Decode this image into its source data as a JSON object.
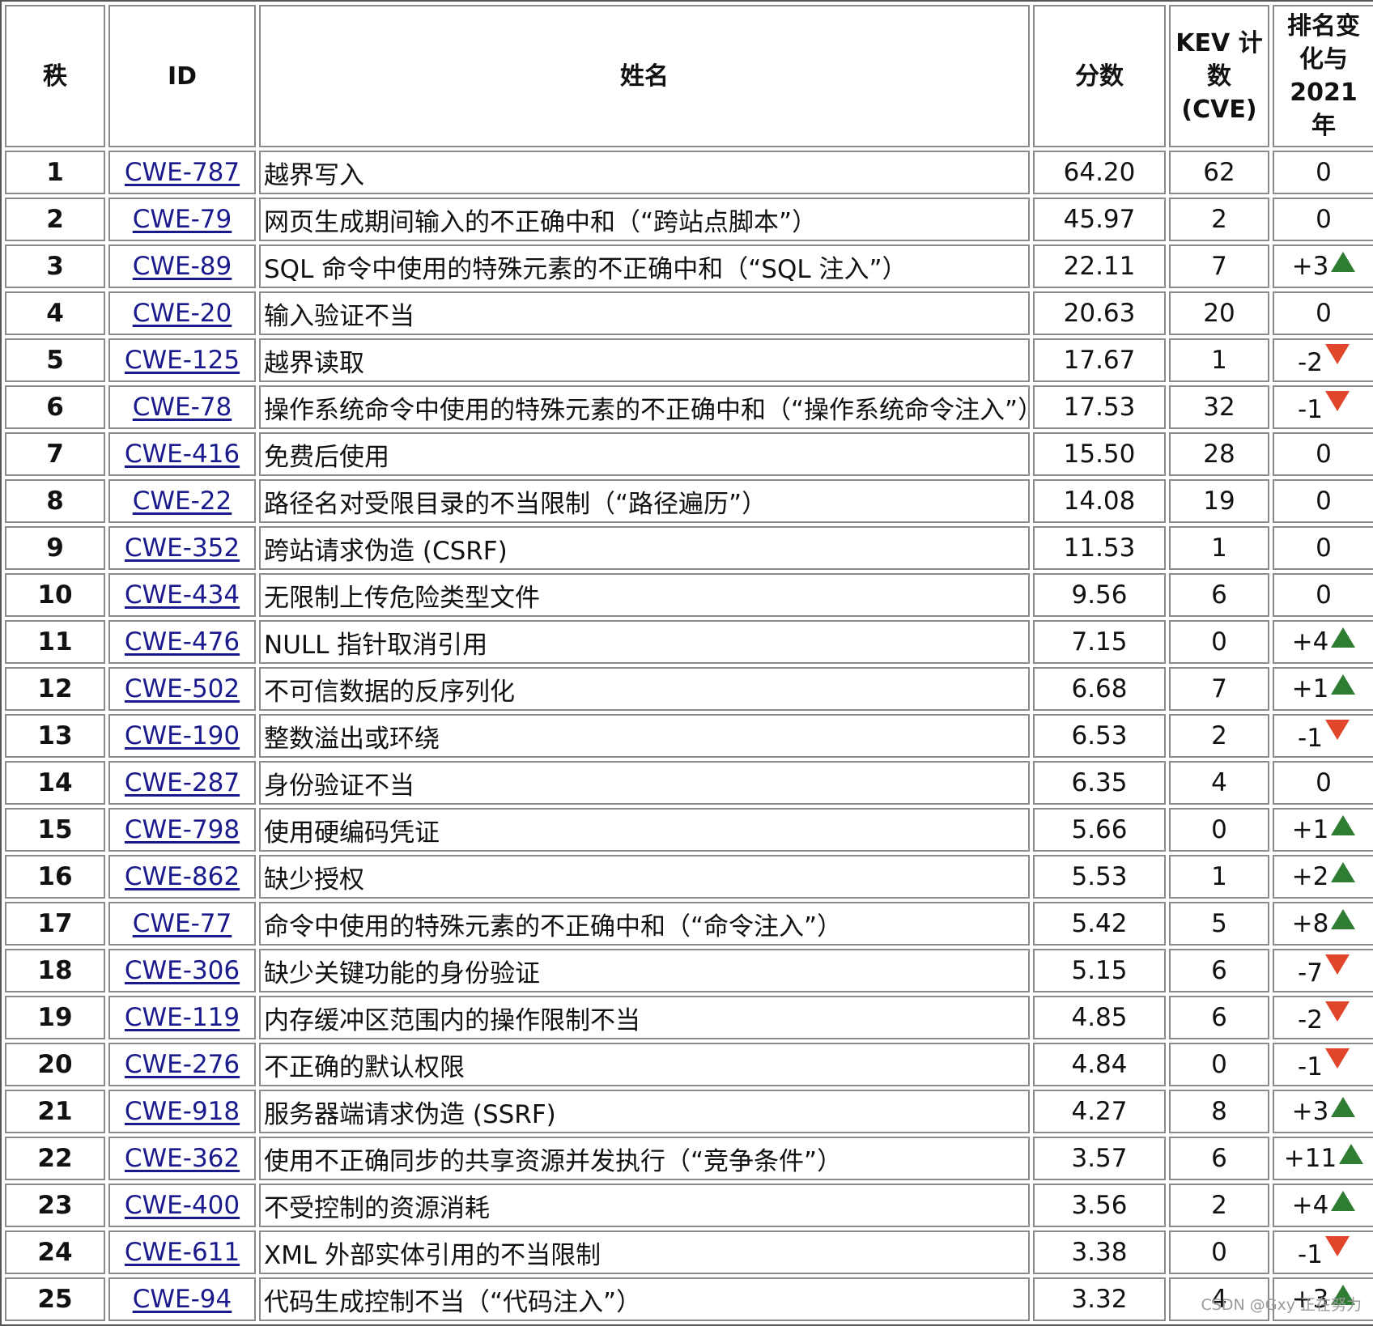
{
  "headers": {
    "rank": "秩",
    "id": "ID",
    "name": "姓名",
    "score": "分数",
    "kev": "KEV 计数 (CVE)",
    "change": "排名变化与 2021 年"
  },
  "rows": [
    {
      "rank": "1",
      "id": "CWE-787",
      "name": "越界写入",
      "score": "64.20",
      "kev": "62",
      "change": "0",
      "trend": "none"
    },
    {
      "rank": "2",
      "id": "CWE-79",
      "name": "网页生成期间输入的不正确中和（“跨站点脚本”）",
      "score": "45.97",
      "kev": "2",
      "change": "0",
      "trend": "none"
    },
    {
      "rank": "3",
      "id": "CWE-89",
      "name": "SQL 命令中使用的特殊元素的不正确中和（“SQL 注入”）",
      "score": "22.11",
      "kev": "7",
      "change": "+3",
      "trend": "up"
    },
    {
      "rank": "4",
      "id": "CWE-20",
      "name": "输入验证不当",
      "score": "20.63",
      "kev": "20",
      "change": "0",
      "trend": "none"
    },
    {
      "rank": "5",
      "id": "CWE-125",
      "name": "越界读取",
      "score": "17.67",
      "kev": "1",
      "change": "-2",
      "trend": "down"
    },
    {
      "rank": "6",
      "id": "CWE-78",
      "name": "操作系统命令中使用的特殊元素的不正确中和（“操作系统命令注入”）",
      "score": "17.53",
      "kev": "32",
      "change": "-1",
      "trend": "down"
    },
    {
      "rank": "7",
      "id": "CWE-416",
      "name": "免费后使用",
      "score": "15.50",
      "kev": "28",
      "change": "0",
      "trend": "none"
    },
    {
      "rank": "8",
      "id": "CWE-22",
      "name": "路径名对受限目录的不当限制（“路径遍历”）",
      "score": "14.08",
      "kev": "19",
      "change": "0",
      "trend": "none"
    },
    {
      "rank": "9",
      "id": "CWE-352",
      "name": "跨站请求伪造 (CSRF)",
      "score": "11.53",
      "kev": "1",
      "change": "0",
      "trend": "none"
    },
    {
      "rank": "10",
      "id": "CWE-434",
      "name": "无限制上传危险类型文件",
      "score": "9.56",
      "kev": "6",
      "change": "0",
      "trend": "none"
    },
    {
      "rank": "11",
      "id": "CWE-476",
      "name": "NULL 指针取消引用",
      "score": "7.15",
      "kev": "0",
      "change": "+4",
      "trend": "up"
    },
    {
      "rank": "12",
      "id": "CWE-502",
      "name": "不可信数据的反序列化",
      "score": "6.68",
      "kev": "7",
      "change": "+1",
      "trend": "up"
    },
    {
      "rank": "13",
      "id": "CWE-190",
      "name": "整数溢出或环绕",
      "score": "6.53",
      "kev": "2",
      "change": "-1",
      "trend": "down"
    },
    {
      "rank": "14",
      "id": "CWE-287",
      "name": "身份验证不当",
      "score": "6.35",
      "kev": "4",
      "change": "0",
      "trend": "none"
    },
    {
      "rank": "15",
      "id": "CWE-798",
      "name": "使用硬编码凭证",
      "score": "5.66",
      "kev": "0",
      "change": "+1",
      "trend": "up"
    },
    {
      "rank": "16",
      "id": "CWE-862",
      "name": "缺少授权",
      "score": "5.53",
      "kev": "1",
      "change": "+2",
      "trend": "up"
    },
    {
      "rank": "17",
      "id": "CWE-77",
      "name": "命令中使用的特殊元素的不正确中和（“命令注入”）",
      "score": "5.42",
      "kev": "5",
      "change": "+8",
      "trend": "up"
    },
    {
      "rank": "18",
      "id": "CWE-306",
      "name": "缺少关键功能的身份验证",
      "score": "5.15",
      "kev": "6",
      "change": "-7",
      "trend": "down"
    },
    {
      "rank": "19",
      "id": "CWE-119",
      "name": "内存缓冲区范围内的操作限制不当",
      "score": "4.85",
      "kev": "6",
      "change": "-2",
      "trend": "down"
    },
    {
      "rank": "20",
      "id": "CWE-276",
      "name": "不正确的默认权限",
      "score": "4.84",
      "kev": "0",
      "change": "-1",
      "trend": "down"
    },
    {
      "rank": "21",
      "id": "CWE-918",
      "name": "服务器端请求伪造 (SSRF)",
      "score": "4.27",
      "kev": "8",
      "change": "+3",
      "trend": "up"
    },
    {
      "rank": "22",
      "id": "CWE-362",
      "name": "使用不正确同步的共享资源并发执行（“竞争条件”）",
      "score": "3.57",
      "kev": "6",
      "change": "+11",
      "trend": "up"
    },
    {
      "rank": "23",
      "id": "CWE-400",
      "name": "不受控制的资源消耗",
      "score": "3.56",
      "kev": "2",
      "change": "+4",
      "trend": "up"
    },
    {
      "rank": "24",
      "id": "CWE-611",
      "name": "XML 外部实体引用的不当限制",
      "score": "3.38",
      "kev": "0",
      "change": "-1",
      "trend": "down"
    },
    {
      "rank": "25",
      "id": "CWE-94",
      "name": "代码生成控制不当（“代码注入”）",
      "score": "3.32",
      "kev": "4",
      "change": "+3",
      "trend": "up"
    }
  ],
  "colors": {
    "link": "#1a1a8c",
    "up": "#2e7d32",
    "down": "#e0462a"
  },
  "watermark": "CSDN @Gxy 正在努力"
}
